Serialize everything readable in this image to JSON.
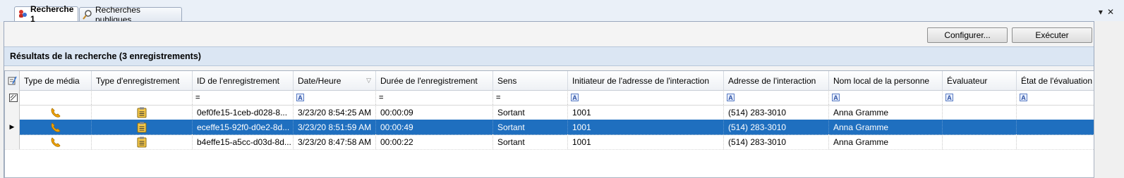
{
  "tabs": [
    {
      "label": "Recherche 1",
      "icon": "search-person-icon",
      "active": true
    },
    {
      "label": "Recherches publiques",
      "icon": "magnifier-icon",
      "active": false
    }
  ],
  "toolbar": {
    "configure_label": "Configurer...",
    "execute_label": "Exécuter"
  },
  "results": {
    "title": "Résultats de la recherche (3 enregistrements)"
  },
  "columns": [
    {
      "label": "Type de média",
      "filter": ""
    },
    {
      "label": "Type d'enregistrement",
      "filter": ""
    },
    {
      "label": "ID de l'enregistrement",
      "filter": "="
    },
    {
      "label": "Date/Heure",
      "filter": "A"
    },
    {
      "label": "Durée de l'enregistrement",
      "filter": "="
    },
    {
      "label": "Sens",
      "filter": "="
    },
    {
      "label": "Initiateur de l'adresse de l'interaction",
      "filter": "A"
    },
    {
      "label": "Adresse de l'interaction",
      "filter": "A"
    },
    {
      "label": "Nom local de la personne",
      "filter": "A"
    },
    {
      "label": "Évaluateur",
      "filter": "A"
    },
    {
      "label": "État de l'évaluation",
      "filter": "A"
    }
  ],
  "rows": [
    {
      "id": "0ef0fe15-1ceb-d028-8...",
      "datetime": "3/23/20 8:54:25 AM",
      "duration": "00:00:09",
      "direction": "Sortant",
      "initiator": "1001",
      "address": "(514) 283-3010",
      "person": "Anna Gramme",
      "evaluator": "",
      "evaluation_state": "",
      "selected": false
    },
    {
      "id": "eceffe15-92f0-d0e2-8d...",
      "datetime": "3/23/20 8:51:59 AM",
      "duration": "00:00:49",
      "direction": "Sortant",
      "initiator": "1001",
      "address": "(514) 283-3010",
      "person": "Anna Gramme",
      "evaluator": "",
      "evaluation_state": "",
      "selected": true
    },
    {
      "id": "b4effe15-a5cc-d03d-8d...",
      "datetime": "3/23/20 8:47:58 AM",
      "duration": "00:00:22",
      "direction": "Sortant",
      "initiator": "1001",
      "address": "(514) 283-3010",
      "person": "Anna Gramme",
      "evaluator": "",
      "evaluation_state": "",
      "selected": false
    }
  ],
  "colors": {
    "selection": "#1f6fbf",
    "header_band": "#dbe6f3",
    "phone_icon": "#f2a400"
  }
}
